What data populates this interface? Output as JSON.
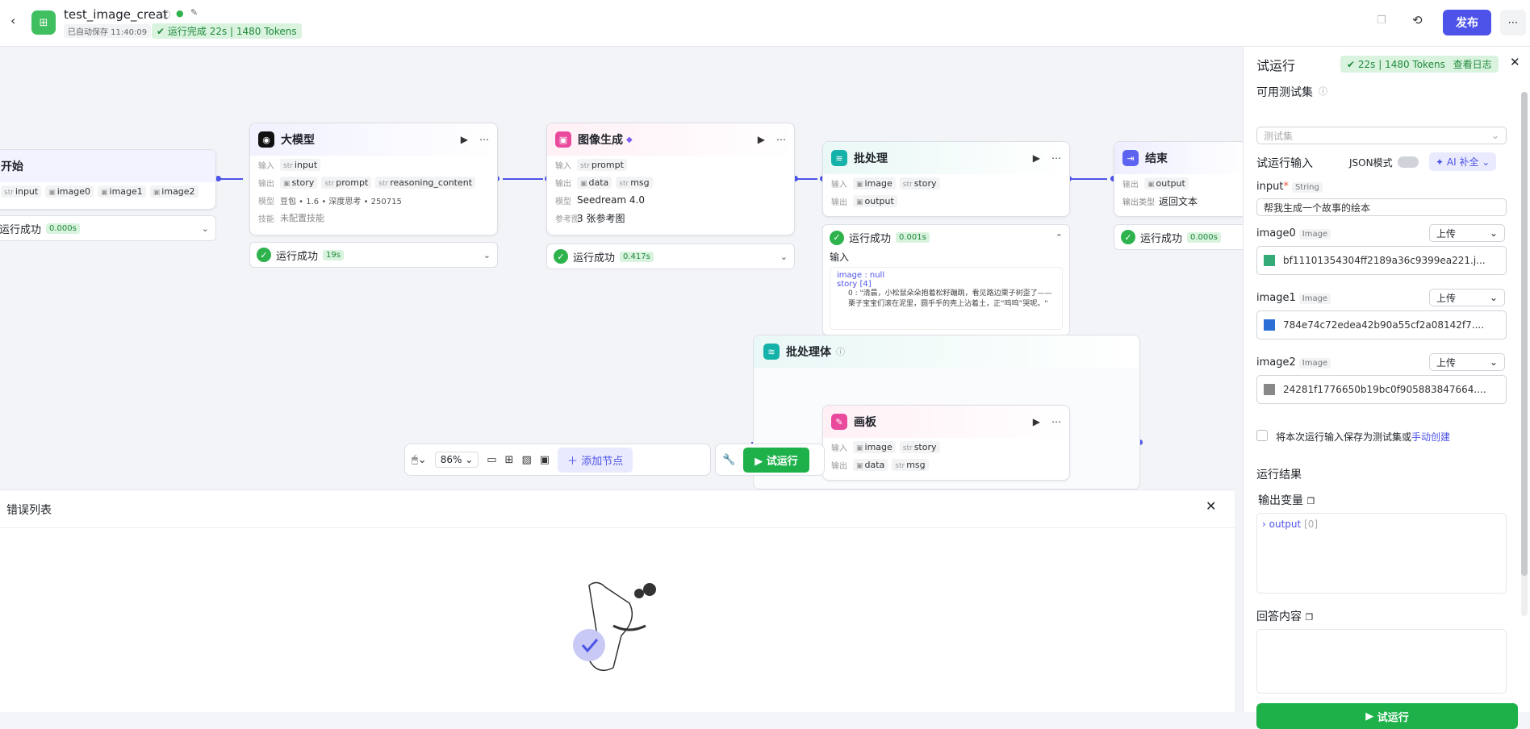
{
  "header": {
    "title": "test_image_creat",
    "autosave": "已自动保存 11:40:09",
    "run_status": "运行完成 22s | 1480 Tokens",
    "publish": "发布"
  },
  "nodes": {
    "start": {
      "title": "开始",
      "outputs": [
        "input",
        "image0",
        "image1",
        "image2"
      ],
      "status": "运行成功",
      "time": "0.000s"
    },
    "llm": {
      "title": "大模型",
      "in_label": "输入",
      "out_label": "输出",
      "model_label": "模型",
      "skill_label": "技能",
      "inputs": [
        "input"
      ],
      "outputs": [
        "story",
        "prompt",
        "reasoning_content"
      ],
      "model": "豆包 • 1.6 • 深度思考 • 250715",
      "skill": "未配置技能",
      "status": "运行成功",
      "time": "19s"
    },
    "img": {
      "title": "图像生成",
      "in_label": "输入",
      "out_label": "输出",
      "model_label": "模型",
      "ref_label": "参考图",
      "inputs": [
        "prompt"
      ],
      "outputs": [
        "data",
        "msg"
      ],
      "model": "Seedream 4.0",
      "ref": "3 张参考图",
      "status": "运行成功",
      "time": "0.417s"
    },
    "batch": {
      "title": "批处理",
      "in_label": "输入",
      "out_label": "输出",
      "inputs": [
        "image",
        "story"
      ],
      "outputs": [
        "output"
      ],
      "status": "运行成功",
      "time": "0.001s",
      "detail_in": "输入",
      "image_line": "image : null",
      "story_line": "story [4]",
      "story_text": "0 : \"清晨，小松鼠朵朵抱着松籽蹦跳，看见路边栗子树歪了——栗子宝宝们滚在泥里，圆乎乎的壳上沾着土，正“呜呜”哭呢。\""
    },
    "end": {
      "title": "结束",
      "out_label": "输出",
      "type_label": "输出类型",
      "outputs": [
        "output"
      ],
      "type": "返回文本",
      "status": "运行成功",
      "time": "0.000s"
    },
    "batchbody": {
      "title": "批处理体"
    },
    "board": {
      "title": "画板",
      "in_label": "输入",
      "out_label": "输出",
      "inputs": [
        "image",
        "story"
      ],
      "outputs": [
        "data",
        "msg"
      ]
    }
  },
  "toolbar": {
    "zoom": "86%",
    "add_node": "添加节点",
    "test_run": "试运行"
  },
  "error_panel": {
    "title": "错误列表"
  },
  "side": {
    "title": "试运行",
    "stats": "22s | 1480 Tokens",
    "view_log": "查看日志",
    "testset_label": "可用测试集",
    "testset_placeholder": "测试集",
    "input_label": "试运行输入",
    "json_mode": "JSON模式",
    "ai_fill": "AI 补全",
    "fields": [
      {
        "name": "input",
        "required": "*",
        "type": "String",
        "value": "帮我生成一个故事的绘本"
      },
      {
        "name": "image0",
        "type": "Image",
        "mode": "上传",
        "value": "bf11101354304ff2189a36c9399ea221.j..."
      },
      {
        "name": "image1",
        "type": "Image",
        "mode": "上传",
        "value": "784e74c72edea42b90a55cf2a08142f7...."
      },
      {
        "name": "image2",
        "type": "Image",
        "mode": "上传",
        "value": "24281f1776650b19bc0f905883847664...."
      }
    ],
    "save_text": "将本次运行输入保存为测试集或",
    "manual": "手动创建",
    "result_label": "运行结果",
    "out_var": "输出变量",
    "output_tree": "output",
    "output_count": "[0]",
    "answer": "回答内容",
    "run_btn": "试运行"
  }
}
